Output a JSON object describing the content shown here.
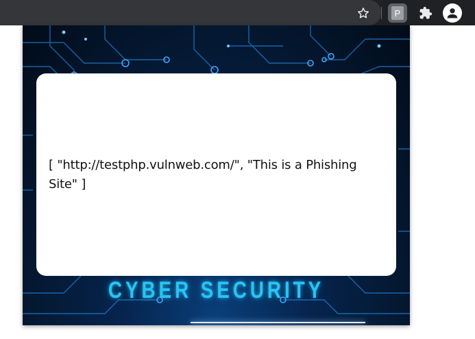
{
  "browser": {
    "extension_letter": "P",
    "icons": [
      "star-icon",
      "extension-p-icon",
      "puzzle-icon",
      "profile-icon"
    ]
  },
  "popup": {
    "message": "[ \"http://testphp.vulnweb.com/\", \"This is a Phishing Site\" ]",
    "banner": "CYBER SECURITY"
  },
  "colors": {
    "accent": "#29c3f5",
    "background_dark": "#04172f",
    "card": "#ffffff",
    "toolbar": "#202124"
  }
}
